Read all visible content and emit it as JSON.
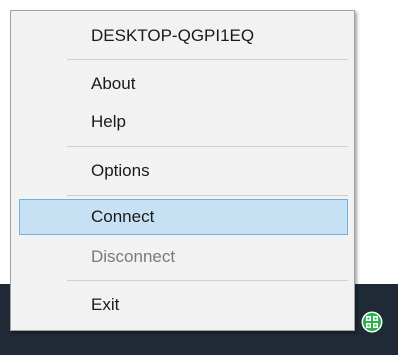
{
  "context_menu": {
    "header": "DESKTOP-QGPI1EQ",
    "items": [
      {
        "label": "About",
        "enabled": true,
        "highlighted": false
      },
      {
        "label": "Help",
        "enabled": true,
        "highlighted": false
      },
      {
        "label": "Options",
        "enabled": true,
        "highlighted": false
      },
      {
        "label": "Connect",
        "enabled": true,
        "highlighted": true
      },
      {
        "label": "Disconnect",
        "enabled": false,
        "highlighted": false
      },
      {
        "label": "Exit",
        "enabled": true,
        "highlighted": false
      }
    ]
  },
  "taskbar": {
    "background_color": "#1f2a36",
    "tray_icons": [
      "show-hidden-icons-chevron-icon",
      "remote-app-tray-icon"
    ],
    "app_icon_color": "#2bb34a"
  },
  "colors": {
    "highlight_fill": "#c6e1f3",
    "highlight_border": "#71b1dc",
    "disabled_text": "#7a7a7a"
  }
}
